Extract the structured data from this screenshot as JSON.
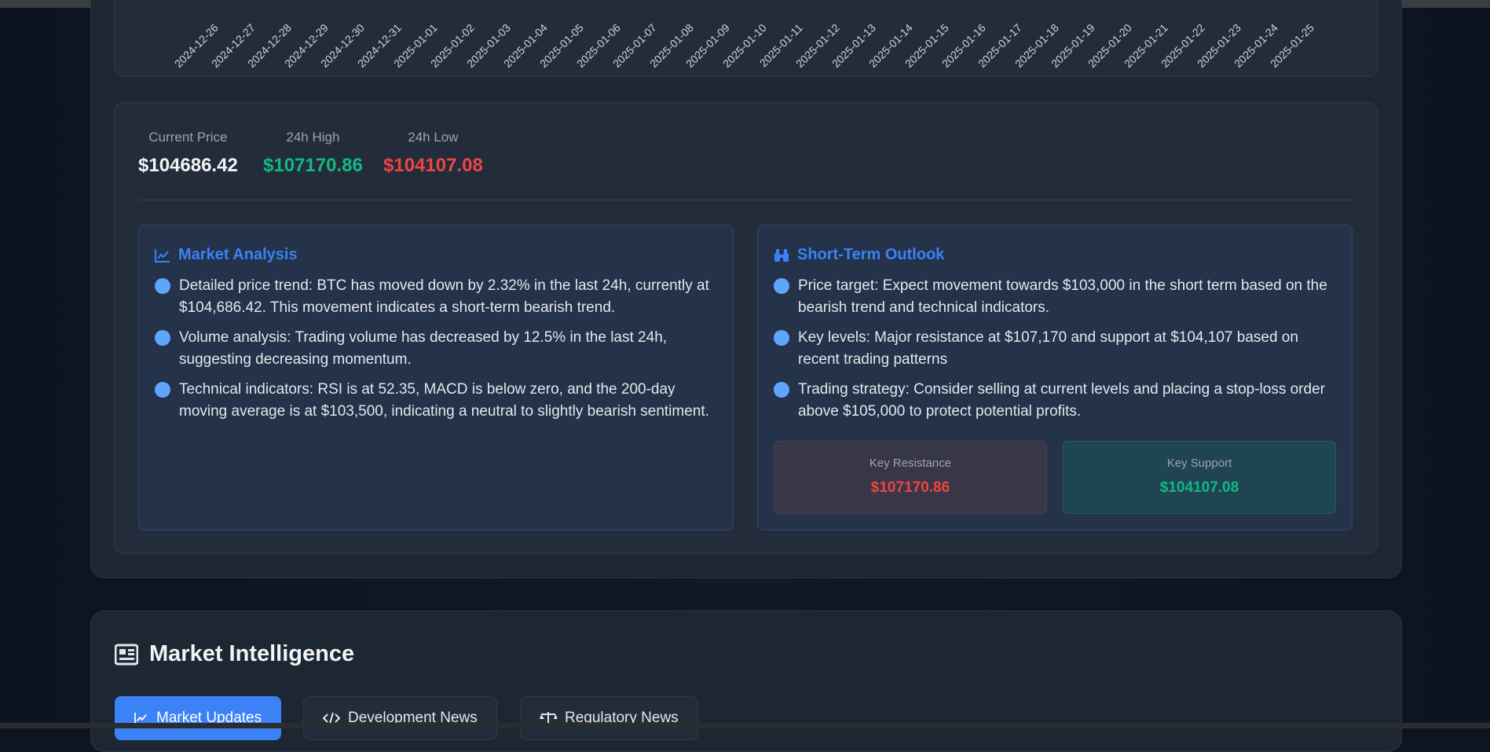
{
  "chart": {
    "x_ticks": [
      "2024-12-26",
      "2024-12-27",
      "2024-12-28",
      "2024-12-29",
      "2024-12-30",
      "2024-12-31",
      "2025-01-01",
      "2025-01-02",
      "2025-01-03",
      "2025-01-04",
      "2025-01-05",
      "2025-01-06",
      "2025-01-07",
      "2025-01-08",
      "2025-01-09",
      "2025-01-10",
      "2025-01-11",
      "2025-01-12",
      "2025-01-13",
      "2025-01-14",
      "2025-01-15",
      "2025-01-16",
      "2025-01-17",
      "2025-01-18",
      "2025-01-19",
      "2025-01-20",
      "2025-01-21",
      "2025-01-22",
      "2025-01-23",
      "2025-01-24",
      "2025-01-25"
    ]
  },
  "stats": {
    "current_label": "Current Price",
    "current_value": "$104686.42",
    "high_label": "24h High",
    "high_value": "$107170.86",
    "low_label": "24h Low",
    "low_value": "$104107.08"
  },
  "market_analysis": {
    "title": "Market Analysis",
    "icon": "chart-line-icon",
    "items": [
      "Detailed price trend: BTC has moved down by 2.32% in the last 24h, currently at $104,686.42. This movement indicates a short-term bearish trend.",
      "Volume analysis: Trading volume has decreased by 12.5% in the last 24h, suggesting decreasing momentum.",
      "Technical indicators: RSI is at 52.35, MACD is below zero, and the 200-day moving average is at $103,500, indicating a neutral to slightly bearish sentiment."
    ]
  },
  "outlook": {
    "title": "Short-Term Outlook",
    "icon": "binoculars-icon",
    "items": [
      "Price target: Expect movement towards $103,000 in the short term based on the bearish trend and technical indicators.",
      "Key levels: Major resistance at $107,170 and support at $104,107 based on recent trading patterns",
      "Trading strategy: Consider selling at current levels and placing a stop-loss order above $105,000 to protect potential profits."
    ],
    "resistance_label": "Key Resistance",
    "resistance_value": "$107170.86",
    "support_label": "Key Support",
    "support_value": "$104107.08"
  },
  "intelligence": {
    "title": "Market Intelligence",
    "icon": "newspaper-icon",
    "tabs": [
      {
        "label": "Market Updates",
        "icon": "chart-line-icon",
        "active": true
      },
      {
        "label": "Development News",
        "icon": "code-icon",
        "active": false
      },
      {
        "label": "Regulatory News",
        "icon": "scale-icon",
        "active": false
      }
    ]
  },
  "colors": {
    "accent": "#3b82f6",
    "positive": "#10b981",
    "negative": "#ef4444"
  }
}
